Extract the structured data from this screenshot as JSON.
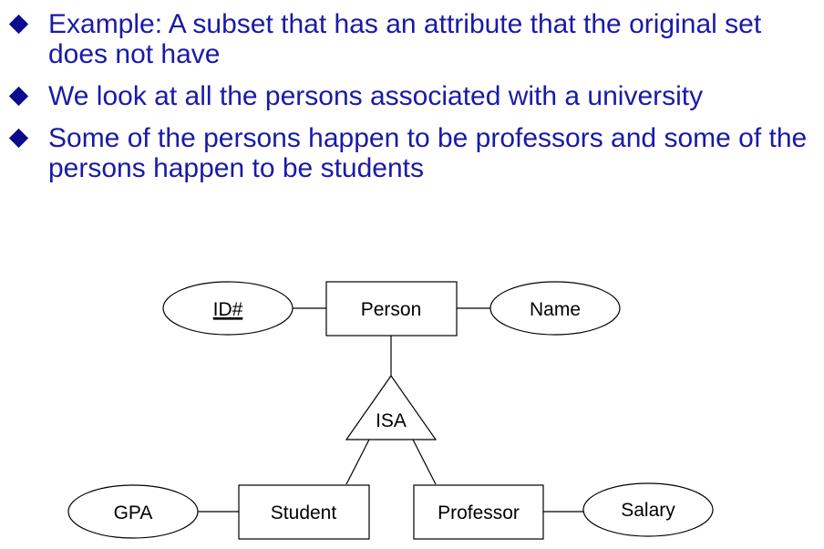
{
  "bullets": [
    "Example: A subset that has an attribute that the original set does not have",
    "We look at all the persons associated with a university",
    "Some of the persons happen to be professors and some of the persons happen to be students"
  ],
  "diagram": {
    "entities": {
      "person": "Person",
      "student": "Student",
      "professor": "Professor"
    },
    "attributes": {
      "id": "ID#",
      "name": "Name",
      "gpa": "GPA",
      "salary": "Salary"
    },
    "relationship": "ISA"
  },
  "colors": {
    "bullet_text": "#1a1aa6",
    "bullet_marker": "#0b0b8e",
    "diagram_stroke": "#000000"
  }
}
